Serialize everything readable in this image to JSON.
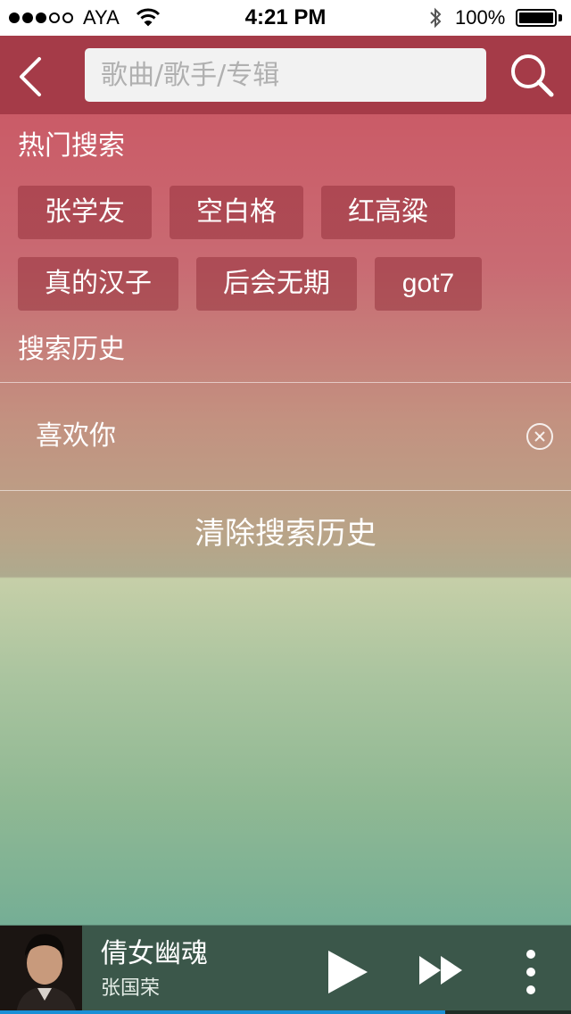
{
  "status_bar": {
    "carrier": "AYA",
    "time": "4:21 PM",
    "battery": "100%",
    "signal_bars_filled": 3,
    "signal_bars_total": 5
  },
  "search": {
    "placeholder": "歌曲/歌手/专辑",
    "value": ""
  },
  "hot_search": {
    "title": "热门搜索",
    "tags": [
      "张学友",
      "空白格",
      "红高粱",
      "真的汉子",
      "后会无期",
      "got7"
    ]
  },
  "history": {
    "title": "搜索历史",
    "items": [
      "喜欢你"
    ],
    "clear_label": "清除搜索历史"
  },
  "player": {
    "song": "倩女幽魂",
    "artist": "张国荣",
    "progress": 0.78
  },
  "colors": {
    "nav_bg": "#a53b48",
    "player_bg": "#3b574a",
    "progress": "#1a8fd6"
  },
  "icons": {
    "back": "chevron-left-icon",
    "search": "magnifier-icon",
    "delete": "circle-x-icon",
    "play": "play-icon",
    "next": "fast-forward-icon",
    "more": "vertical-dots-icon"
  }
}
